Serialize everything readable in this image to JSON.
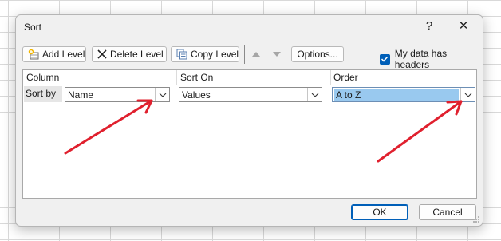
{
  "dialog": {
    "title": "Sort",
    "help_label": "?",
    "close_label": "✕"
  },
  "toolbar": {
    "add_level": "Add Level",
    "delete_level": "Delete Level",
    "copy_level": "Copy Level",
    "options": "Options...",
    "my_data_has_headers": "My data has headers",
    "my_data_has_headers_checked": true
  },
  "table": {
    "headers": [
      "Column",
      "Sort On",
      "Order"
    ],
    "rows": [
      {
        "label": "Sort by",
        "column": "Name",
        "sort_on": "Values",
        "order": "A to Z"
      }
    ]
  },
  "footer": {
    "ok": "OK",
    "cancel": "Cancel"
  },
  "colors": {
    "accent": "#005fb8",
    "selection": "#99c9ef",
    "annotation_arrow": "#e0202e"
  }
}
